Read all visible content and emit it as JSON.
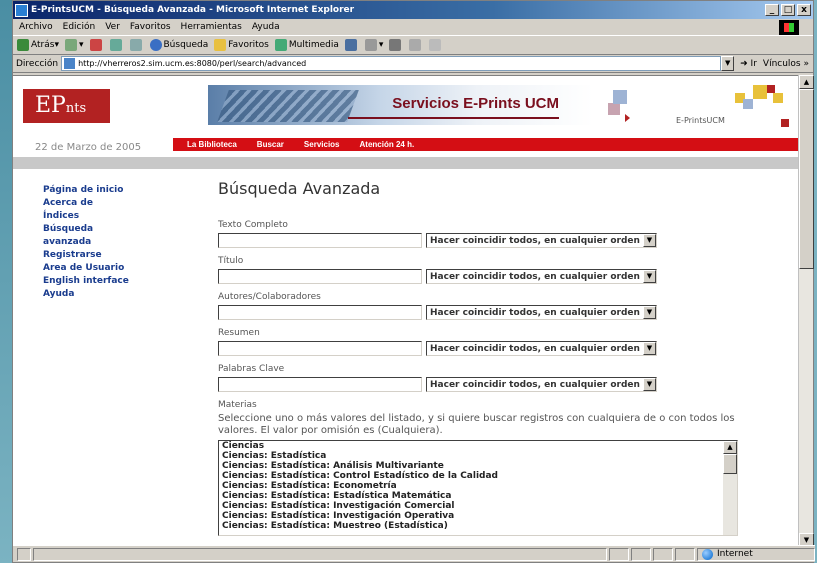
{
  "window": {
    "title": "E-PrintsUCM - Búsqueda Avanzada - Microsoft Internet Explorer"
  },
  "menu": [
    "Archivo",
    "Edición",
    "Ver",
    "Favoritos",
    "Herramientas",
    "Ayuda"
  ],
  "toolbar": {
    "back": "Atrás",
    "search": "Búsqueda",
    "favorites": "Favoritos",
    "multimedia": "Multimedia"
  },
  "address": {
    "label": "Dirección",
    "url": "http://vherreros2.sim.ucm.es:8080/perl/search/advanced",
    "go": "Ir",
    "links": "Vínculos"
  },
  "header": {
    "logo_main": "EP",
    "logo_small": "nts",
    "slogan": "Servicios E-Prints UCM",
    "brand": "E-PrintsUCM",
    "date": "22 de Marzo de 2005",
    "nav": [
      "La Biblioteca",
      "Buscar",
      "Servicios",
      "Atención 24 h."
    ]
  },
  "sidebar": [
    "Página de inicio",
    "Acerca de",
    "Índices",
    "Búsqueda avanzada",
    "Registrarse",
    "Area de Usuario",
    "English interface",
    "Ayuda"
  ],
  "main": {
    "heading": "Búsqueda Avanzada",
    "fields": [
      {
        "label": "Texto Completo",
        "value": "",
        "match": "Hacer coincidir todos, en cualquier orden"
      },
      {
        "label": "Título",
        "value": "",
        "match": "Hacer coincidir todos, en cualquier orden"
      },
      {
        "label": "Autores/Colaboradores",
        "value": "",
        "match": "Hacer coincidir todos, en cualquier orden"
      },
      {
        "label": "Resumen",
        "value": "",
        "match": "Hacer coincidir todos, en cualquier orden"
      },
      {
        "label": "Palabras Clave",
        "value": "",
        "match": "Hacer coincidir todos, en cualquier orden"
      }
    ],
    "materias": {
      "label": "Materias",
      "help": "Seleccione uno o más valores del listado, y si quiere buscar registros con cualquiera de o con todos los valores. El valor por omisión es (Cualquiera).",
      "options": [
        "Ciencias",
        "Ciencias: Estadística",
        "Ciencias: Estadística: Análisis Multivariante",
        "Ciencias: Estadística: Control Estadístico de la Calidad",
        "Ciencias: Estadística: Econometría",
        "Ciencias: Estadística: Estadística Matemática",
        "Ciencias: Estadística: Investigación Comercial",
        "Ciencias: Estadística: Investigación Operativa",
        "Ciencias: Estadística: Muestreo (Estadística)"
      ]
    }
  },
  "status": {
    "zone": "Internet"
  }
}
